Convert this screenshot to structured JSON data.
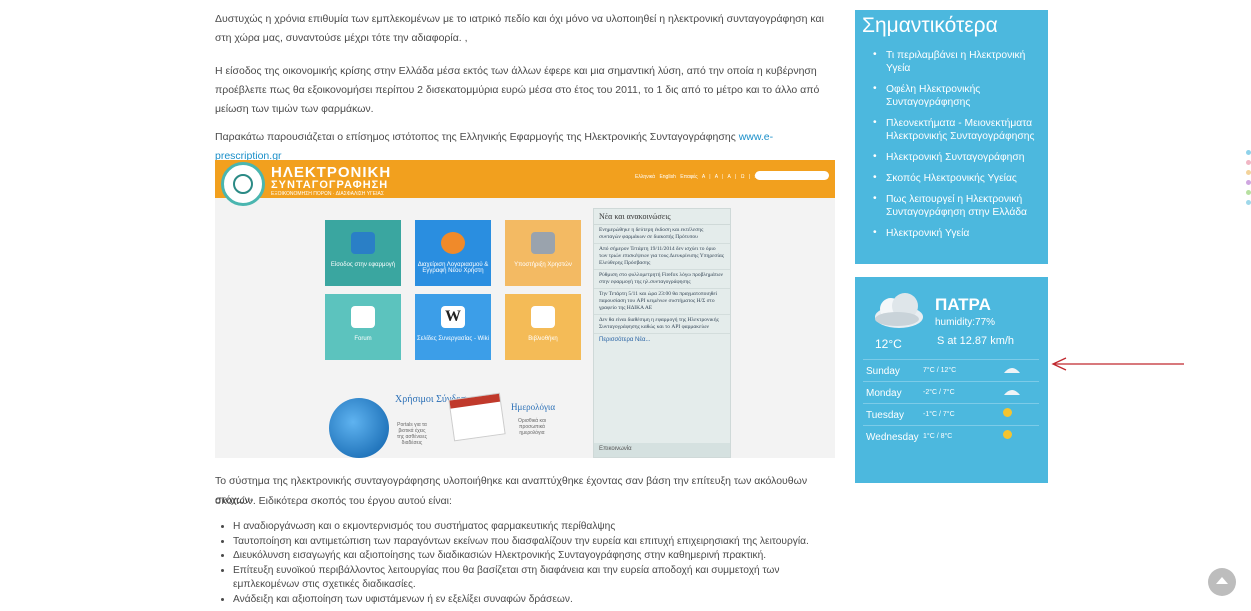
{
  "article": {
    "p1": "Δυστυχώς η χρόνια επιθυμία των εμπλεκομένων με το ιατρικό πεδίο και όχι μόνο να υλοποιηθεί η ηλεκτρονική συνταγογράφηση και στη χώρα μας, συναντούσε μέχρι τότε την αδιαφορία. ,",
    "p2": "Η είσοδος της οικονομικής κρίσης στην Ελλάδα μέσα εκτός των άλλων έφερε και μια σημαντική λύση, από την οποία η κυβέρνηση προέβλεπε πως θα εξοικονομήσει περίπου 2 δισεκατομμύρια ευρώ μέσα στο έτος του 2011, το 1 δις από το μέτρο και το άλλο από μείωση των τιμών των φαρμάκων.",
    "p3_text": "Παρακάτω παρουσιάζεται ο επίσημος ιστότοπος της Ελληνικής Εφαρμογής της Ηλεκτρονικής Συνταγογράφησης",
    "p3_link": "www.e-prescription.gr",
    "p4": "Το σύστημα της ηλεκτρονικής συνταγογράφησης υλοποιήθηκε και αναπτύχθηκε έχοντας σαν βάση την επίτευξη των ακόλουθων στόχων-",
    "p5": "σκοπών. Ειδικότερα σκοπός του έργου αυτού είναι:",
    "bullets": [
      "Η αναδιοργάνωση και ο εκμοντερνισμός του συστήματος φαρμακευτικής περίθαλψης",
      "Ταυτοποίηση και αντιμετώπιση των παραγόντων εκείνων που διασφαλίζουν την ευρεία και επιτυχή επιχειρησιακή της λειτουργία.",
      "Διευκόλυνση εισαγωγής και αξιοποίησης των διαδικασιών Ηλεκτρονικής Συνταγογράφησης στην καθημερινή πρακτική.",
      "Επίτευξη ευνοϊκού περιβάλλοντος λειτουργίας που θα βασίζεται στη διαφάνεια και την ευρεία αποδοχή και συμμετοχή των εμπλεκομένων στις σχετικές διαδικασίες.",
      "Ανάδειξη και αξιοποίηση των υφιστάμενων ή εν εξελίξει συναφών δράσεων."
    ]
  },
  "screenshot": {
    "title1": "ΗΛΕΚΤΡΟΝΙΚΗ",
    "title2": "ΣΥΝΤΑΓΟΓΡΑΦΗΣΗ",
    "title3": "ΕΞΟΙΚΟΝΟΜΗΣΗ ΠΟΡΩΝ · ΔΙΑΣΦΑΛΙΣΗ ΥΓΕΙΑΣ",
    "nav": "Ελληνικά English Επαφές Α | Α | Α | Ω | Ω",
    "tiles": [
      "Είσοδος στην εφαρμογή",
      "Διαχείριση Λογαριασμού & Εγγραφή Νέου Χρήστη",
      "Υποστήριξη Χρηστών",
      "Forum",
      "Σελίδες Συνεργασίας - Wiki",
      "Βιβλιοθήκη"
    ],
    "news_title": "Νέα και ανακοινώσεις",
    "news": [
      "Ενημερώθηκε η δεύτερη έκδοση και εκτέλεσης συνταγών φαρμάκων σε διακοπής Πρότυπου",
      "Από σήμερον Τετάρτη 19/11/2014 δεν ισχύει το όριο των τριών επισκέψεων για τους Διευκρίνισης Υπηρεσίας Ελεύθερης Πρόσβασης",
      "Ρύθμιση στο φυλλομετρητή Firefox λόγω προβλημάτων στην εφαρμογή της ηλ.συνταγογράφησης",
      "Την Τετάρτη 5/11 και ώρα 23:00 θα πραγματοποιηθεί παρουσίαση του API κειμένων συστήματος Η/Σ στο γραφείο της ΗΔΙΚΑ ΑΕ",
      "Δεν θα είναι διαθέσιμη η εφαρμογή της Ηλεκτρονικής Συνταγογράφησης καθώς και το API φαρμακείων"
    ],
    "news_more": "Περισσότερα Νέα...",
    "news_foot": "Επικοινωνία",
    "links_title": "Χρήσιμοι Σύνδεσμοι",
    "links_sub": "Portals για τα βιοτικά έχεις της ασθένειες διαδέσεις",
    "calendar_label": "Calendar",
    "calendar_title": "Ημερολόγια",
    "calendar_sub": "Ορισθικά και προσωπικά ημερολόγια"
  },
  "sidebar": {
    "title": "Σημαντικότερα",
    "items": [
      "Τι περιλαμβάνει η Ηλεκτρονική Υγεία",
      "Οφέλη Ηλεκτρονικής Συνταγογράφησης",
      "Πλεονεκτήματα - Μειονεκτήματα Ηλεκτρονικής Συνταγογράφησης",
      "Ηλεκτρονική Συνταγογράφηση",
      "Σκοπός Ηλεκτρονικής Υγείας",
      "Πως λειτουργεί η Ηλεκτρονική Συνταγογράφηση στην Ελλάδα",
      "Ηλεκτρονική Υγεία"
    ]
  },
  "weather": {
    "city": "ΠΑΤΡΑ",
    "humidity": "humidity:77%",
    "temp": "12°C",
    "wind": "S at 12.87 km/h",
    "forecast": [
      {
        "day": "Sunday",
        "range": "7°C / 12°C",
        "icon": "cloud-icon"
      },
      {
        "day": "Monday",
        "range": "-2°C / 7°C",
        "icon": "cloud-icon"
      },
      {
        "day": "Tuesday",
        "range": "-1°C / 7°C",
        "icon": "sun-icon"
      },
      {
        "day": "Wednesday",
        "range": "1°C / 8°C",
        "icon": "sun-icon"
      }
    ]
  },
  "colors": {
    "sidebar_bg": "#4cb8de",
    "link": "#1a8fc9",
    "arrow": "#c0272d",
    "header_orange": "#f2a01e"
  }
}
